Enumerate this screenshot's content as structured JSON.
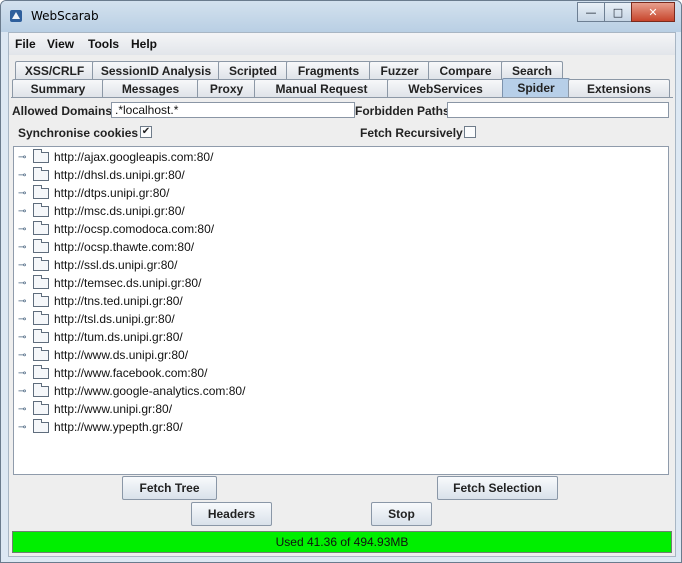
{
  "window": {
    "title": "WebScarab",
    "controls": {
      "minimize": "—",
      "maximize": "□",
      "close": "✕"
    }
  },
  "menu": [
    "File",
    "View",
    "Tools",
    "Help"
  ],
  "tabs_row1": [
    "XSS/CRLF",
    "SessionID Analysis",
    "Scripted",
    "Fragments",
    "Fuzzer",
    "Compare",
    "Search"
  ],
  "tabs_row2": [
    "Summary",
    "Messages",
    "Proxy",
    "Manual Request",
    "WebServices",
    "Spider",
    "Extensions"
  ],
  "active_tab": "Spider",
  "spider": {
    "allowed_domains_label": "Allowed Domains",
    "allowed_domains_value": ".*localhost.*",
    "forbidden_paths_label": "Forbidden Paths",
    "forbidden_paths_value": "",
    "sync_cookies_label": "Synchronise cookies",
    "sync_cookies_checked": "✔",
    "fetch_recursively_label": "Fetch Recursively",
    "fetch_recursively_checked": ""
  },
  "tree_items": [
    "http://ajax.googleapis.com:80/",
    "http://dhsl.ds.unipi.gr:80/",
    "http://dtps.unipi.gr:80/",
    "http://msc.ds.unipi.gr:80/",
    "http://ocsp.comodoca.com:80/",
    "http://ocsp.thawte.com:80/",
    "http://ssl.ds.unipi.gr:80/",
    "http://temsec.ds.unipi.gr:80/",
    "http://tns.ted.unipi.gr:80/",
    "http://tsl.ds.unipi.gr:80/",
    "http://tum.ds.unipi.gr:80/",
    "http://www.ds.unipi.gr:80/",
    "http://www.facebook.com:80/",
    "http://www.google-analytics.com:80/",
    "http://www.unipi.gr:80/",
    "http://www.ypepth.gr:80/"
  ],
  "buttons": {
    "fetch_tree": "Fetch Tree",
    "fetch_selection": "Fetch Selection",
    "headers": "Headers",
    "stop": "Stop"
  },
  "memory": {
    "text": "Used 41.36 of 494.93MB",
    "color": "#00ef00"
  },
  "colors": {
    "active_tab": "#b7cfe8",
    "titlebar": "#c9daeb"
  }
}
